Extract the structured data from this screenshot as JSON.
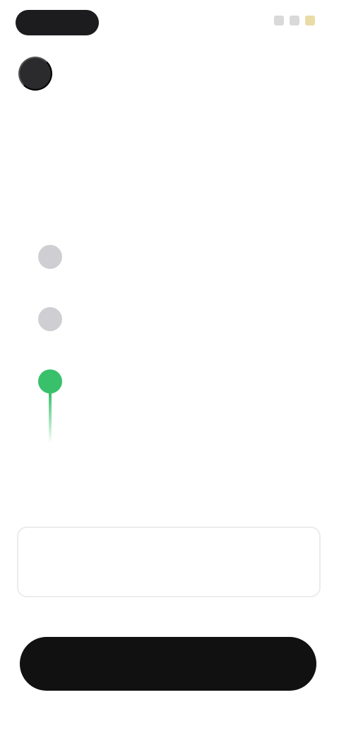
{
  "header": {
    "back_icon": "back-arrow-icon"
  },
  "page": {
    "title": ""
  },
  "timeline": {
    "steps": [
      {
        "title": "",
        "description": "",
        "state": "pending"
      },
      {
        "title": "",
        "description": "",
        "state": "pending"
      },
      {
        "title": "",
        "description": "",
        "state": "active"
      }
    ],
    "active_color": "#38c06a"
  },
  "summary": {
    "label": "",
    "sublabel": "",
    "value": ""
  },
  "primary_button": {
    "label": ""
  },
  "footer": {
    "links": [
      "",
      "",
      ""
    ]
  }
}
